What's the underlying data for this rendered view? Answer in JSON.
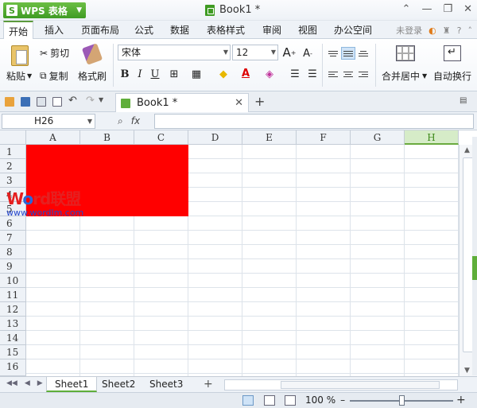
{
  "titlebar": {
    "app_name": "WPS 表格",
    "logo_letter": "S",
    "document_title": "Book1 *"
  },
  "menu": {
    "tabs": [
      "开始",
      "插入",
      "页面布局",
      "公式",
      "数据",
      "表格样式",
      "审阅",
      "视图",
      "办公空间"
    ],
    "login": "未登录"
  },
  "ribbon": {
    "paste": "粘贴",
    "cut": "剪切",
    "copy": "复制",
    "format_painter": "格式刷",
    "font_name": "宋体",
    "font_size": "12",
    "merge_center": "合并居中",
    "auto_wrap": "自动换行"
  },
  "doc_tab": {
    "title": "Book1 *"
  },
  "formula_bar": {
    "cell_ref": "H26",
    "fx": "fx",
    "formula": ""
  },
  "grid": {
    "columns": [
      "A",
      "B",
      "C",
      "D",
      "E",
      "F",
      "G",
      "H"
    ],
    "active_column": "H",
    "rows": [
      "1",
      "2",
      "3",
      "4",
      "5",
      "6",
      "7",
      "8",
      "9",
      "10",
      "11",
      "12",
      "13",
      "14",
      "15",
      "16"
    ],
    "fill_color": "#ff0000",
    "fill_range": "A1:C5"
  },
  "watermark": {
    "title_w": "W",
    "title_o": "o",
    "title_rest": "rd联盟",
    "url": "www.wordlm.com"
  },
  "sheets": {
    "tabs": [
      "Sheet1",
      "Sheet2",
      "Sheet3"
    ],
    "active": "Sheet1"
  },
  "status": {
    "zoom": "100 %"
  },
  "colors": {
    "accent_green": "#5fae3a",
    "header_bg": "#eef2f7"
  }
}
